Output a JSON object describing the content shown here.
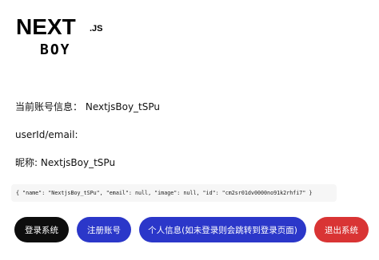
{
  "logo": {
    "main": "NEXT",
    "suffix": ".JS",
    "sub": "BOY"
  },
  "account_info": {
    "label": "当前账号信息：",
    "value": "NextjsBoy_tSPu"
  },
  "user_id": {
    "label": "userId/email:",
    "value": ""
  },
  "nickname": {
    "label": "昵称:",
    "value": "NextjsBoy_tSPu"
  },
  "session_json": "{ \"name\": \"NextjsBoy_tSPu\", \"email\": null, \"image\": null, \"id\": \"cm2sr01dv0000no91k2rhfi7\" }",
  "buttons": {
    "login": "登录系统",
    "register": "注册账号",
    "profile": "个人信息(如未登录则会跳转到登录页面)",
    "logout": "退出系统"
  },
  "colors": {
    "login_bg": "#0d0d0d",
    "primary_bg": "#2b37c9",
    "logout_bg": "#d93434",
    "json_bg": "#f6f6f6"
  }
}
